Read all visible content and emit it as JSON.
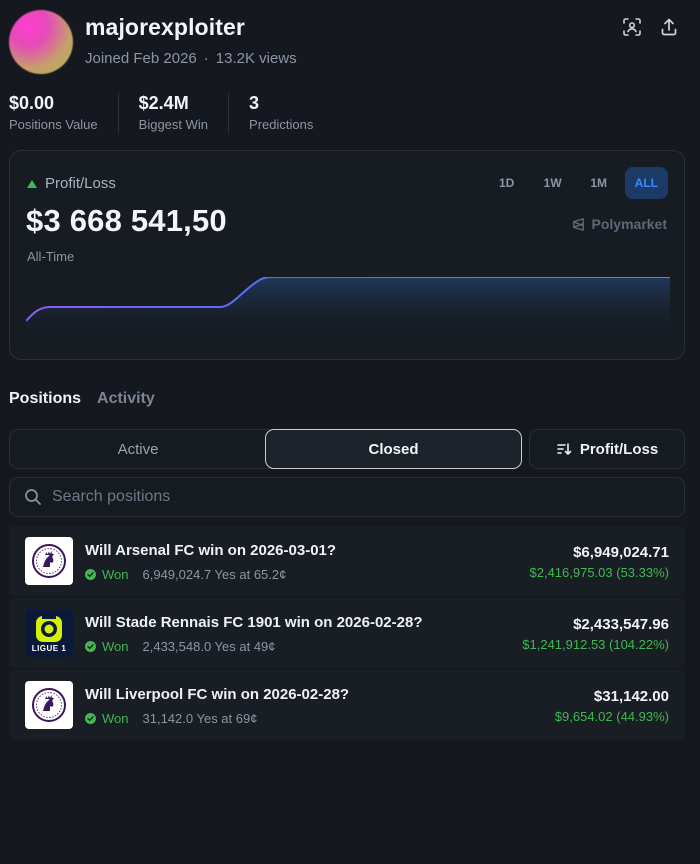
{
  "profile": {
    "username": "majorexploiter",
    "joined": "Joined Feb 2026",
    "views": "13.2K views"
  },
  "stats": [
    {
      "value": "$0.00",
      "label": "Positions Value"
    },
    {
      "value": "$2.4M",
      "label": "Biggest Win"
    },
    {
      "value": "3",
      "label": "Predictions"
    }
  ],
  "pl": {
    "title": "Profit/Loss",
    "amount": "$3 668 541,50",
    "period": "All-Time",
    "brand": "Polymarket",
    "ranges": [
      "1D",
      "1W",
      "1M",
      "ALL"
    ],
    "active_range": "ALL",
    "line_color": "#3b8bff",
    "line_color_start": "#8a5cf6"
  },
  "tabs": [
    "Positions",
    "Activity"
  ],
  "filter": {
    "active_label": "Active",
    "closed_label": "Closed",
    "sort_label": "Profit/Loss"
  },
  "search": {
    "placeholder": "Search positions"
  },
  "positions": [
    {
      "logo": "premier-league",
      "question": "Will Arsenal FC win on 2026-03-01?",
      "status": "Won",
      "detail": "6,949,024.7 Yes at 65.2¢",
      "amount": "$6,949,024.71",
      "pnl": "$2,416,975.03 (53.33%)"
    },
    {
      "logo": "ligue-1",
      "logo_text": "LIGUE 1",
      "question": "Will Stade Rennais FC 1901 win on 2026-02-28?",
      "status": "Won",
      "detail": "2,433,548.0 Yes at 49¢",
      "amount": "$2,433,547.96",
      "pnl": "$1,241,912.53 (104.22%)"
    },
    {
      "logo": "premier-league",
      "question": "Will Liverpool FC win on 2026-02-28?",
      "status": "Won",
      "detail": "31,142.0 Yes at 69¢",
      "amount": "$31,142.00",
      "pnl": "$9,654.02 (44.93%)"
    }
  ],
  "colors": {
    "accent": "#3b8bff",
    "positive": "#3fb950",
    "background": "#15191f"
  }
}
